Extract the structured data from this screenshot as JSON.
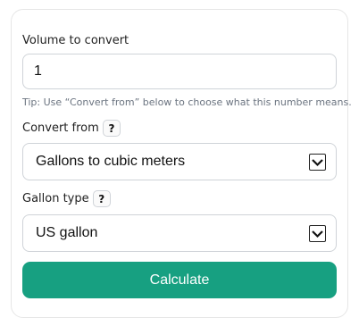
{
  "volume": {
    "label": "Volume to convert",
    "value": "1",
    "tip": "Tip: Use “Convert from” below to choose what this number means."
  },
  "convert_from": {
    "label": "Convert from",
    "help": "?",
    "selected": "Gallons to cubic meters"
  },
  "gallon_type": {
    "label": "Gallon type",
    "help": "?",
    "selected": "US gallon"
  },
  "calculate_button": {
    "label": "Calculate"
  },
  "colors": {
    "accent": "#17a081",
    "border": "#cfd3d8",
    "tip_text": "#6b7480"
  },
  "icons": {
    "help": "question-mark-icon",
    "dropdown": "chevron-down-icon"
  }
}
